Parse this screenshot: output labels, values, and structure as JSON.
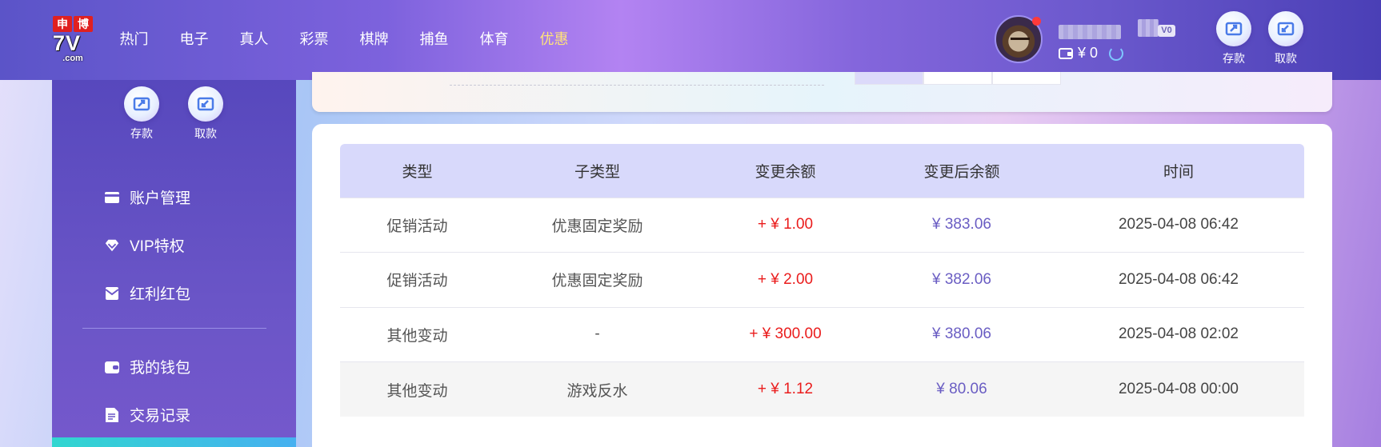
{
  "header": {
    "logo": {
      "top_left": "申",
      "top_right": "博",
      "main": "7V",
      "sub": ".com"
    },
    "nav": [
      {
        "label": "热门",
        "active": false
      },
      {
        "label": "电子",
        "active": false
      },
      {
        "label": "真人",
        "active": false
      },
      {
        "label": "彩票",
        "active": false
      },
      {
        "label": "棋牌",
        "active": false
      },
      {
        "label": "捕鱼",
        "active": false
      },
      {
        "label": "体育",
        "active": false
      },
      {
        "label": "优惠",
        "active": true
      }
    ],
    "vip_level": "V0",
    "balance": "¥ 0",
    "deposit_label": "存款",
    "withdraw_label": "取款"
  },
  "sidebar": {
    "deposit_label": "存款",
    "withdraw_label": "取款",
    "items": [
      {
        "label": "账户管理",
        "icon": "card-icon"
      },
      {
        "label": "VIP特权",
        "icon": "diamond-icon"
      },
      {
        "label": "红利红包",
        "icon": "envelope-icon"
      },
      {
        "label": "我的钱包",
        "icon": "wallet-icon"
      },
      {
        "label": "交易记录",
        "icon": "document-icon"
      }
    ]
  },
  "table": {
    "headers": [
      "类型",
      "子类型",
      "变更余额",
      "变更后余额",
      "时间"
    ],
    "rows": [
      {
        "type": "促销活动",
        "subtype": "优惠固定奖励",
        "change": "+ ¥ 1.00",
        "after": "¥ 383.06",
        "time": "2025-04-08 06:42"
      },
      {
        "type": "促销活动",
        "subtype": "优惠固定奖励",
        "change": "+ ¥ 2.00",
        "after": "¥ 382.06",
        "time": "2025-04-08 06:42"
      },
      {
        "type": "其他变动",
        "subtype": "-",
        "change": "+ ¥ 300.00",
        "after": "¥ 380.06",
        "time": "2025-04-08 02:02"
      },
      {
        "type": "其他变动",
        "subtype": "游戏反水",
        "change": "+ ¥ 1.12",
        "after": "¥ 80.06",
        "time": "2025-04-08 00:00"
      }
    ]
  },
  "colors": {
    "header_gradient_mid": "#b383f2",
    "sidebar": "#5748bd",
    "nav_active": "#ffe27a",
    "amount_positive": "#ea1c1c",
    "balance_after": "#6a5dc3",
    "table_header_bg": "#d8d9fb"
  }
}
